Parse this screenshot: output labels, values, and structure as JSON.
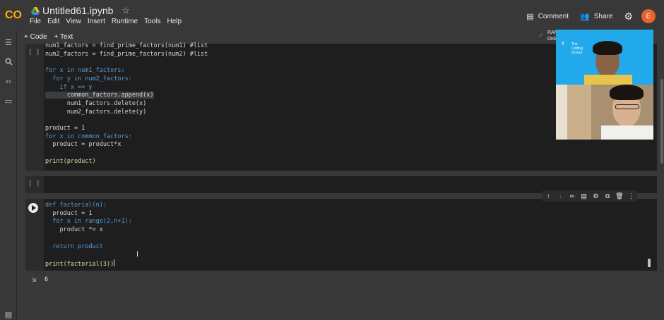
{
  "header": {
    "logo": "CO",
    "notebook_title": "Untitled61.ipynb",
    "menu": [
      "File",
      "Edit",
      "View",
      "Insert",
      "Runtime",
      "Tools",
      "Help"
    ],
    "comment_label": "Comment",
    "share_label": "Share",
    "avatar_letter": "E"
  },
  "toolbar": {
    "code_label": "+ Code",
    "text_label": "+ Text",
    "ram_label": "RAM",
    "disk_label": "Disk"
  },
  "cells": {
    "cell1": {
      "bracket": "[ ]",
      "lines": [
        "num1_factors = find_prime_factors(num1) #list",
        "num2_factors = find_prime_factors(num2) #list",
        "",
        "for x in num1_factors:",
        "  for y in num2_factors:",
        "    if x == y",
        "      common_factors.append(x)",
        "      num1_factors.delete(x)",
        "      num2_factors.delete(y)",
        "",
        "product = 1",
        "for x in common_factors:",
        "  product = product*x",
        "",
        "print(product)"
      ]
    },
    "cell2": {
      "bracket": "[ ]"
    },
    "cell3": {
      "lines": [
        "def factorial(n):",
        "  product = 1",
        "  for x in range(2,n+1):",
        "    product *= x",
        "",
        "  return product",
        "",
        "print(factorial(3))"
      ]
    },
    "output": "6"
  },
  "cell_toolbar_icons": [
    "arrow-up-icon",
    "arrow-down-icon",
    "link-icon",
    "comment-icon",
    "gear-icon",
    "mirror-icon",
    "delete-icon",
    "more-icon"
  ],
  "webcam": {
    "school_line1": "The",
    "school_line2": "Coding",
    "school_line3": "School"
  }
}
